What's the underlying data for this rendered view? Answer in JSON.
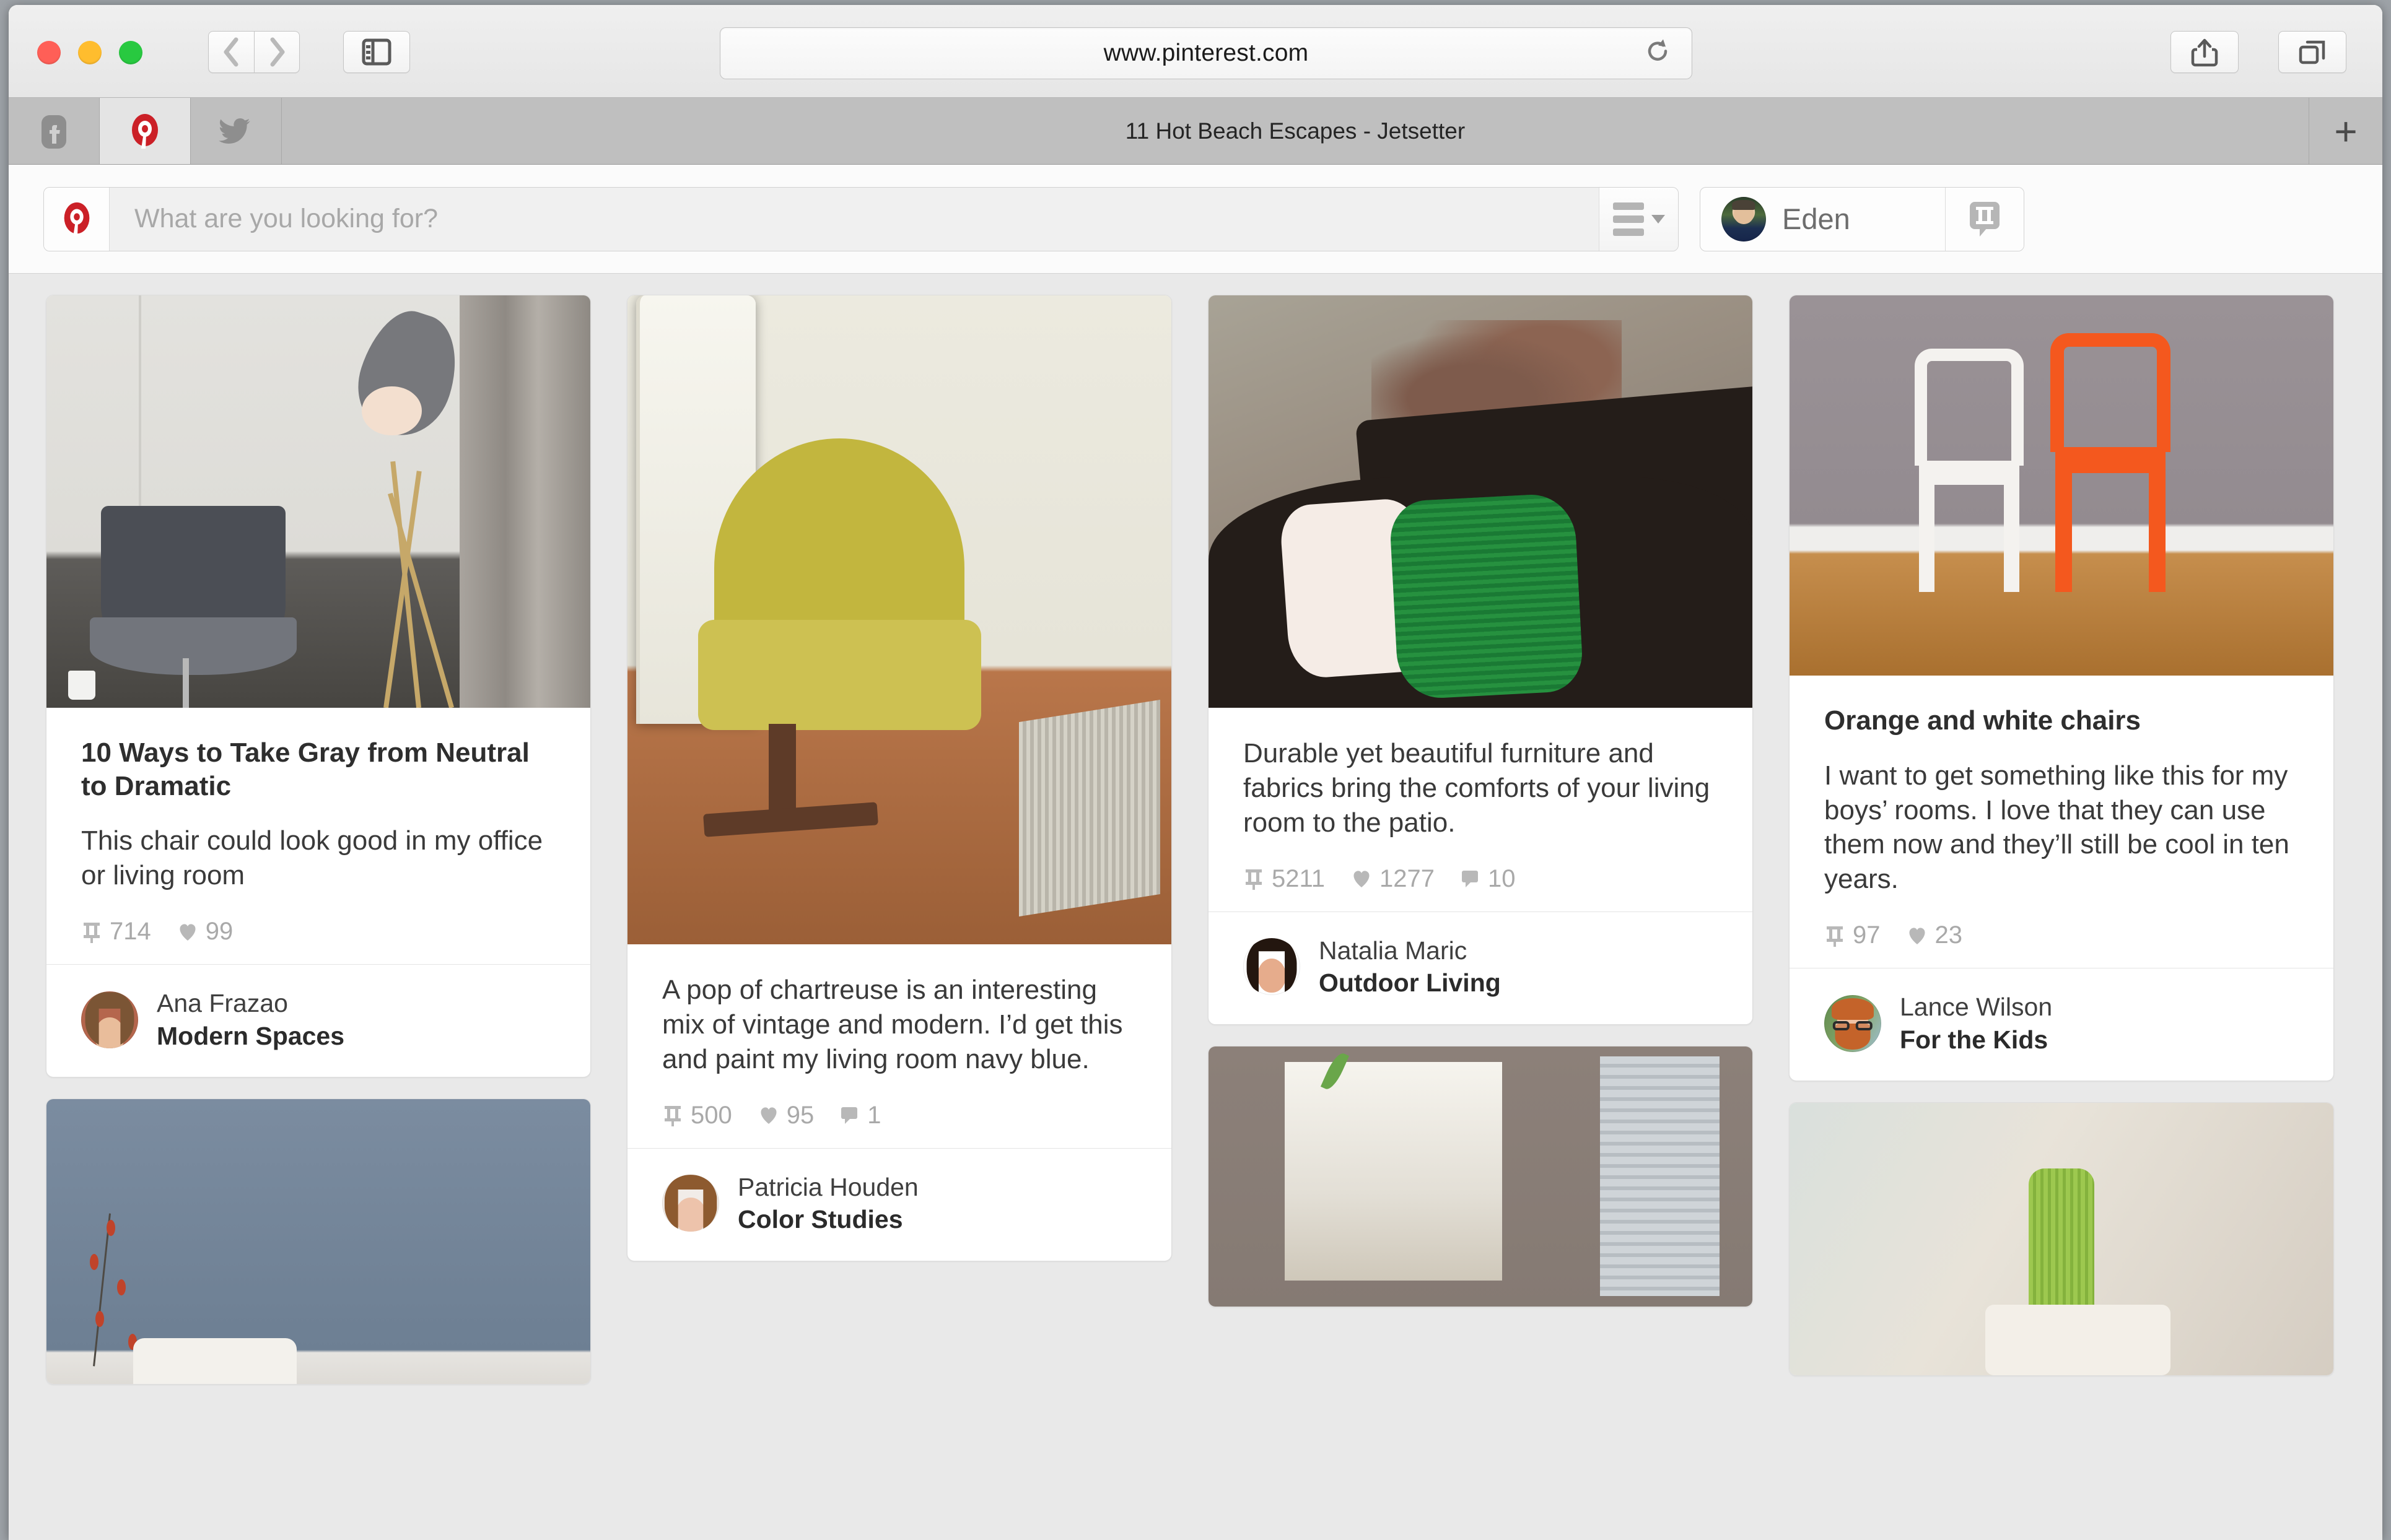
{
  "browser": {
    "url": "www.pinterest.com",
    "reload_icon": "reload-icon",
    "back_icon": "chevron-left-icon",
    "forward_icon": "chevron-right-icon",
    "sidebar_icon": "sidebar-icon",
    "share_icon": "share-icon",
    "tab_overview_icon": "tab-overview-icon",
    "new_tab_label": "+",
    "tabs": [
      {
        "icon": "facebook-icon",
        "active": false
      },
      {
        "icon": "pinterest-icon",
        "active": true
      },
      {
        "icon": "twitter-icon",
        "active": false
      }
    ],
    "active_tab_title": "11 Hot Beach Escapes - Jetsetter"
  },
  "pinterest_header": {
    "logo_icon": "pinterest-logo-icon",
    "search_placeholder": "What are you looking for?",
    "search_value": "",
    "filter_icon": "hamburger-filter-icon",
    "user_name": "Eden",
    "pin_it_icon": "pin-it-icon"
  },
  "colors": {
    "pinterest_red": "#cb2027",
    "board_background": "#e9e9e9",
    "card_background": "#ffffff",
    "stat_text": "#a9a9a9",
    "accent_orange": "#f4581e"
  },
  "icons": {
    "pin_icon": "pin-icon",
    "heart_icon": "heart-icon",
    "comment_icon": "comment-icon"
  },
  "pins": [
    {
      "id": "pin-gray-chair",
      "title": "10 Ways to Take Gray from Neutral to Dramatic",
      "description": "This chair could look good in my office or living room",
      "repins": "714",
      "likes": "99",
      "comments": null,
      "author_name": "Ana Frazao",
      "board_name": "Modern Spaces",
      "image_alt": "gray-chair-and-tripod-lamp-photo"
    },
    {
      "id": "pin-chartreuse-chair",
      "title": null,
      "description": "A pop of chartreuse is an interesting mix of vintage and modern. I’d get this and paint my living room navy blue.",
      "repins": "500",
      "likes": "95",
      "comments": "1",
      "author_name": "Patricia Houden",
      "board_name": "Color Studies",
      "image_alt": "chartreuse-swivel-chair-photo"
    },
    {
      "id": "pin-patio-pillows",
      "title": null,
      "description": "Durable yet beautiful furniture and fabrics bring the comforts of your living room to the patio.",
      "repins": "5211",
      "likes": "1277",
      "comments": "10",
      "author_name": "Natalia Maric",
      "board_name": "Outdoor Living",
      "image_alt": "green-and-white-pillows-on-patio-bench-photo"
    },
    {
      "id": "pin-orange-white-chairs",
      "title": "Orange and white chairs",
      "description": "I want to get something like this for my boys’ rooms. I love that they can use them now and they’ll still be cool in ten years.",
      "repins": "97",
      "likes": "23",
      "comments": null,
      "author_name": "Lance Wilson",
      "board_name": "For the Kids",
      "image_alt": "orange-and-white-chairs-photo"
    }
  ],
  "partial_pins": [
    {
      "id": "pin-blue-wall",
      "image_alt": "blue-gray-wall-with-red-berries-photo"
    },
    {
      "id": "pin-mirror-shelf",
      "image_alt": "mirror-and-shelving-photo"
    },
    {
      "id": "pin-cactus",
      "image_alt": "cactus-in-white-pot-photo"
    }
  ]
}
